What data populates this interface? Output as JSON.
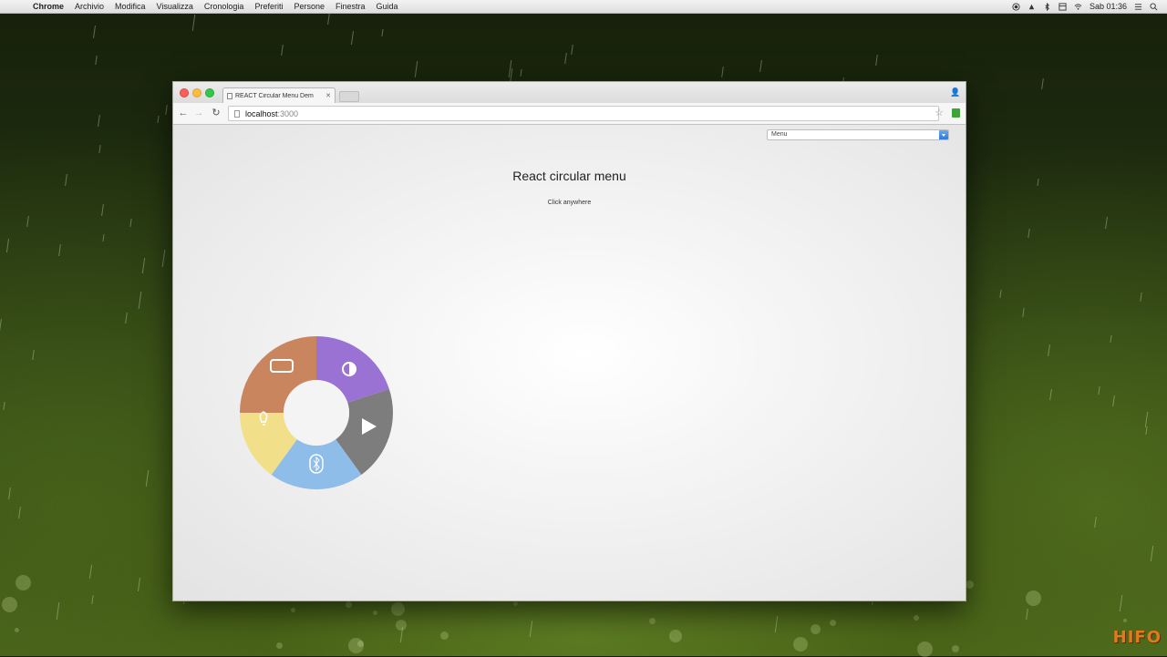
{
  "menubar": {
    "items": [
      "Chrome",
      "Archivio",
      "Modifica",
      "Visualizza",
      "Cronologia",
      "Preferiti",
      "Persone",
      "Finestra",
      "Guida"
    ],
    "clock": "Sab 01:36"
  },
  "browser": {
    "tab_title": "REACT Circular Menu Dem",
    "address_host": "localhost",
    "address_port": ":3000"
  },
  "page": {
    "menu_select": "Menu",
    "title": "React circular menu",
    "subtitle": "Click anywhere"
  },
  "circular_menu": {
    "segments": [
      {
        "name": "battery",
        "color": "#c9855e",
        "icon": "battery-icon"
      },
      {
        "name": "contrast",
        "color": "#9a72d4",
        "icon": "contrast-icon"
      },
      {
        "name": "play",
        "color": "#7d7d7d",
        "icon": "play-icon"
      },
      {
        "name": "bluetooth",
        "color": "#8dbde8",
        "icon": "bluetooth-icon"
      },
      {
        "name": "bulb",
        "color": "#f1df8a",
        "icon": "lightbulb-icon"
      }
    ]
  },
  "watermark": "HIFO"
}
